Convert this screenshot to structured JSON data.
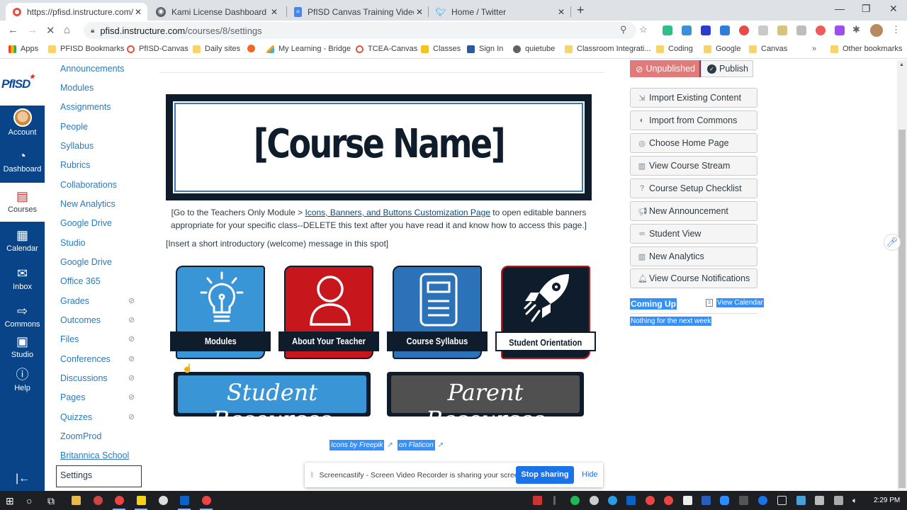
{
  "browser": {
    "tabs": [
      {
        "label": "https://pfisd.instructure.com/cou",
        "icon": "canvas-icon",
        "active": true
      },
      {
        "label": "Kami License Dashboard",
        "icon": "globe-icon",
        "active": false
      },
      {
        "label": "PfISD Canvas Training Videos - G",
        "icon": "google-docs-icon",
        "active": false
      },
      {
        "label": "Home / Twitter",
        "icon": "twitter-icon",
        "active": false
      }
    ],
    "new_tab": "+",
    "window_controls": {
      "minimize": "—",
      "restore": "❐",
      "close": "✕"
    },
    "nav": {
      "back": "←",
      "forward": "→",
      "stop": "✕",
      "home": "⌂"
    },
    "url_host": "pfisd.instructure.com",
    "url_path": "/courses/8/settings",
    "bookmarks": [
      {
        "label": "Apps",
        "icon": "apps-grid-icon"
      },
      {
        "label": "PFISD Bookmarks",
        "icon": "folder-icon"
      },
      {
        "label": "PfISD-Canvas",
        "icon": "canvas-icon"
      },
      {
        "label": "Daily sites",
        "icon": "folder-icon"
      },
      {
        "label": "",
        "icon": "orange-circle-icon"
      },
      {
        "label": "My Learning - Bridge",
        "icon": "bridge-icon"
      },
      {
        "label": "TCEA-Canvas",
        "icon": "canvas-icon"
      },
      {
        "label": "Classes",
        "icon": "classroom-icon"
      },
      {
        "label": "Sign In",
        "icon": "signin-icon"
      },
      {
        "label": "quietube",
        "icon": "globe-icon"
      },
      {
        "label": "Classroom Integrati...",
        "icon": "folder-icon"
      },
      {
        "label": "Coding",
        "icon": "folder-icon"
      },
      {
        "label": "Google",
        "icon": "folder-icon"
      },
      {
        "label": "Canvas",
        "icon": "folder-icon"
      }
    ],
    "bookmarks_overflow": "»",
    "other_bookmarks": "Other bookmarks"
  },
  "global_nav": {
    "items": [
      {
        "label": "Account",
        "icon": "avatar"
      },
      {
        "label": "Dashboard",
        "icon": "dashboard-icon"
      },
      {
        "label": "Courses",
        "icon": "courses-icon",
        "active": true
      },
      {
        "label": "Calendar",
        "icon": "calendar-icon"
      },
      {
        "label": "Inbox",
        "icon": "inbox-icon"
      },
      {
        "label": "Commons",
        "icon": "commons-icon"
      },
      {
        "label": "Studio",
        "icon": "studio-icon"
      },
      {
        "label": "Help",
        "icon": "help-icon"
      }
    ],
    "logo_text": "PfISD",
    "collapse": "|←"
  },
  "course_nav": {
    "items": [
      {
        "label": "Announcements",
        "hidden": false
      },
      {
        "label": "Modules",
        "hidden": false
      },
      {
        "label": "Assignments",
        "hidden": false
      },
      {
        "label": "People",
        "hidden": false
      },
      {
        "label": "Syllabus",
        "hidden": false
      },
      {
        "label": "Rubrics",
        "hidden": false
      },
      {
        "label": "Collaborations",
        "hidden": false
      },
      {
        "label": "New Analytics",
        "hidden": false
      },
      {
        "label": "Google Drive",
        "hidden": false
      },
      {
        "label": "Studio",
        "hidden": false
      },
      {
        "label": "Google Drive",
        "hidden": false
      },
      {
        "label": "Office 365",
        "hidden": false
      },
      {
        "label": "Grades",
        "hidden": true
      },
      {
        "label": "Outcomes",
        "hidden": true
      },
      {
        "label": "Files",
        "hidden": true
      },
      {
        "label": "Conferences",
        "hidden": true
      },
      {
        "label": "Discussions",
        "hidden": true
      },
      {
        "label": "Pages",
        "hidden": true
      },
      {
        "label": "Quizzes",
        "hidden": true
      },
      {
        "label": "ZoomProd",
        "hidden": false
      },
      {
        "label": "Britannica School",
        "hidden": false
      },
      {
        "label": "Settings",
        "hidden": false,
        "active": true
      }
    ],
    "hidden_icon": "eye-slash-icon"
  },
  "main": {
    "banner_title": "[Course Name]",
    "instructions_pre": "[Go to the Teachers Only Module > ",
    "instructions_link": "Icons, Banners, and Buttons Customization Page",
    "instructions_post": " to open editable banners appropriate for your specific class--DELETE this text after you have read it and know how to access this page.]",
    "intro": "[Insert a short introductory (welcome) message in this spot]",
    "tiles": [
      {
        "label": "Modules",
        "icon": "lightbulb-icon",
        "color": "#3a95d6"
      },
      {
        "label": "About Your Teacher",
        "icon": "person-icon",
        "color": "#c8161d"
      },
      {
        "label": "Course Syllabus",
        "icon": "document-icon",
        "color": "#2b72b8"
      },
      {
        "label": "Student Orientation",
        "icon": "rocket-icon",
        "color": "#0e1c2c"
      }
    ],
    "plaques": [
      {
        "label": "Student Resources",
        "color": "#3a95d6"
      },
      {
        "label": "Parent Resources",
        "color": "#505050"
      }
    ],
    "credits": {
      "part1": "Icons by Freepik",
      "part2": "on Flaticon"
    }
  },
  "right_sidebar": {
    "unpublished": "Unpublished",
    "publish": "Publish",
    "buttons": [
      {
        "label": "Import Existing Content",
        "icon": "import-icon"
      },
      {
        "label": "Import from Commons",
        "icon": "commons-icon"
      },
      {
        "label": "Choose Home Page",
        "icon": "target-icon"
      },
      {
        "label": "View Course Stream",
        "icon": "stream-icon"
      },
      {
        "label": "Course Setup Checklist",
        "icon": "question-icon"
      },
      {
        "label": "New Announcement",
        "icon": "megaphone-icon"
      },
      {
        "label": "Student View",
        "icon": "glasses-icon"
      },
      {
        "label": "New Analytics",
        "icon": "analytics-icon"
      },
      {
        "label": "View Course Notifications",
        "icon": "bell-icon"
      }
    ],
    "coming_up": "Coming Up",
    "view_calendar": "View Calendar",
    "calendar_day": "3",
    "nothing": "Nothing for the next week"
  },
  "share_bar": {
    "message": "Screencastify - Screen Video Recorder is sharing your screen.",
    "stop": "Stop sharing",
    "hide": "Hide"
  },
  "taskbar": {
    "time": "2:29 PM"
  }
}
